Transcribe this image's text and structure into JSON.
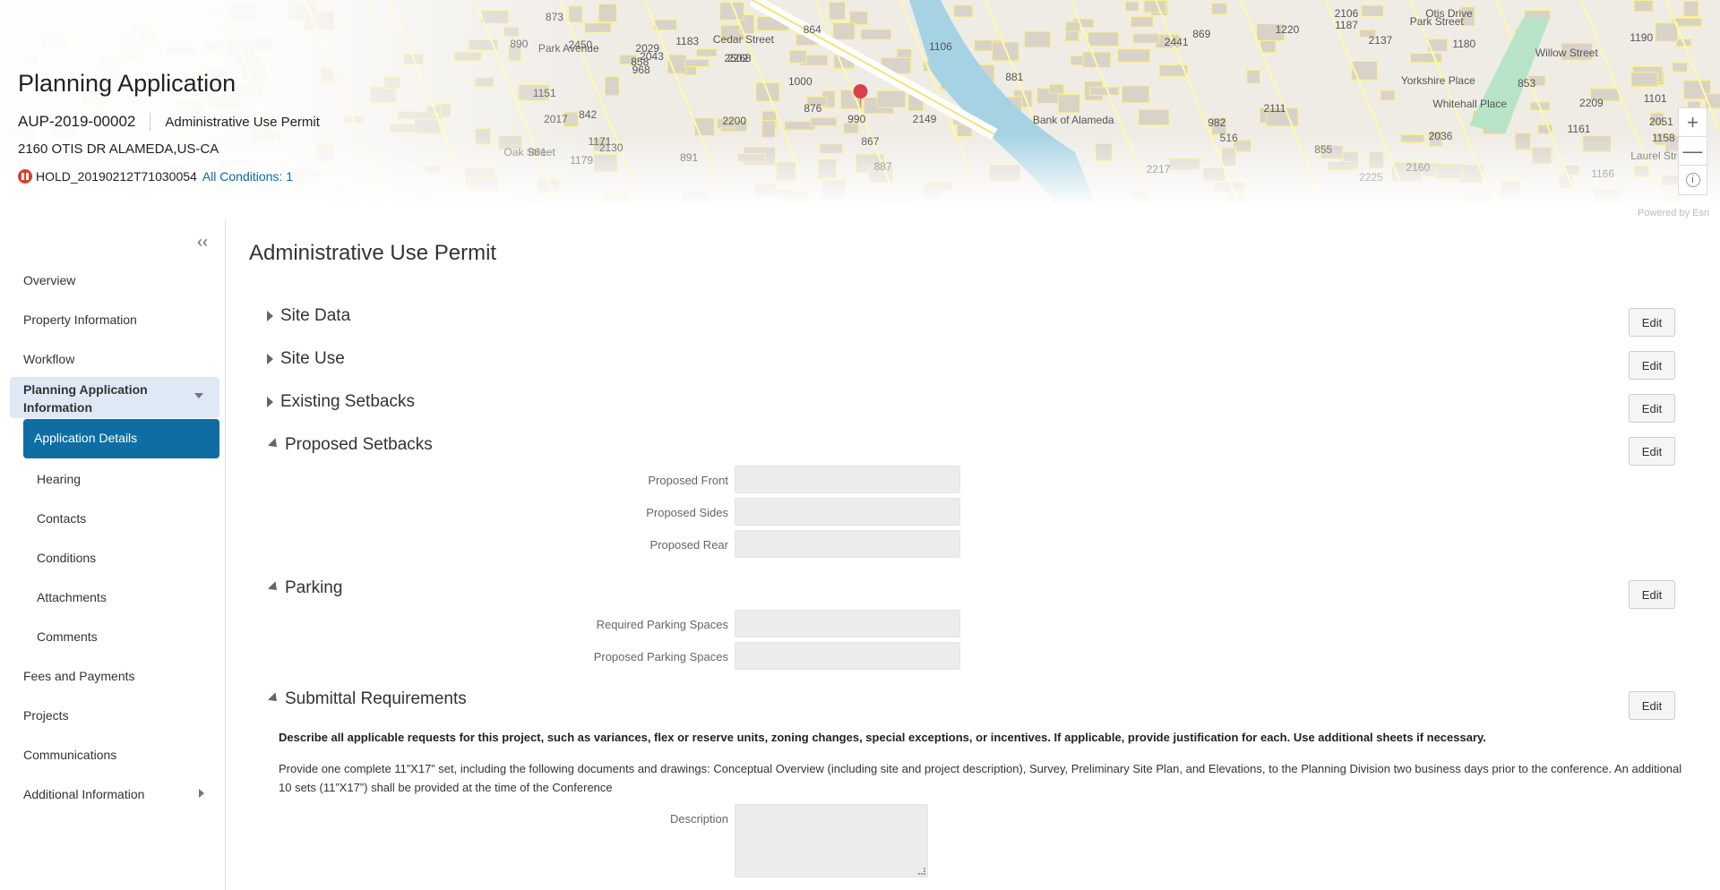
{
  "map": {
    "labels": [
      "Otis Drive",
      "Yorkshire Place",
      "Whitehall Place",
      "Willow Street",
      "Bank of Alameda",
      "2160",
      "2130",
      "2149",
      "2137",
      "2106",
      "2036",
      "2017",
      "2029",
      "2043",
      "2051",
      "516",
      "2111",
      "2209",
      "2217",
      "2225",
      "2200",
      "864",
      "855",
      "858",
      "842",
      "853",
      "861",
      "867",
      "869",
      "876",
      "887",
      "2268",
      "891",
      "881",
      "890",
      "873",
      "1101",
      "1106",
      "1000",
      "990",
      "982",
      "968",
      "1187",
      "1179",
      "1190",
      "2441",
      "2450",
      "1183",
      "2502",
      "1166",
      "1158",
      "1161",
      "1151",
      "1180",
      "1171",
      "1220",
      "Laurel Street",
      "Oak Street",
      "Cedar Street",
      "Park Street",
      "Park Avenue"
    ],
    "zoom_in": "+",
    "zoom_out": "—",
    "info": "i",
    "attribution": "Powered by Esri"
  },
  "header": {
    "title": "Planning Application",
    "record_id": "AUP-2019-00002",
    "record_type": "Administrative Use Permit",
    "address": "2160 OTIS DR ALAMEDA,US-CA",
    "hold_status": "HOLD_20190212T71030054",
    "conditions_link": "All Conditions: 1",
    "status_color": "#d6442a"
  },
  "sidebar": {
    "collapse": "‹‹",
    "items": [
      {
        "label": "Overview"
      },
      {
        "label": "Property Information"
      },
      {
        "label": "Workflow"
      },
      {
        "label": "Planning Application Information"
      },
      {
        "label": "Application Details"
      },
      {
        "label": "Hearing"
      },
      {
        "label": "Contacts"
      },
      {
        "label": "Conditions"
      },
      {
        "label": "Attachments"
      },
      {
        "label": "Comments"
      },
      {
        "label": "Fees and Payments"
      },
      {
        "label": "Projects"
      },
      {
        "label": "Communications"
      },
      {
        "label": "Additional Information"
      }
    ],
    "accent": "#0e6ea3"
  },
  "main": {
    "title": "Administrative Use Permit",
    "edit_label": "Edit",
    "sections": [
      {
        "title": "Site Data",
        "expanded": false
      },
      {
        "title": "Site Use",
        "expanded": false
      },
      {
        "title": "Existing Setbacks",
        "expanded": false
      },
      {
        "title": "Proposed Setbacks",
        "expanded": true,
        "fields": [
          {
            "label": "Proposed Front",
            "value": ""
          },
          {
            "label": "Proposed Sides",
            "value": ""
          },
          {
            "label": "Proposed Rear",
            "value": ""
          }
        ]
      },
      {
        "title": "Parking",
        "expanded": true,
        "fields": [
          {
            "label": "Required Parking Spaces",
            "value": ""
          },
          {
            "label": "Proposed Parking Spaces",
            "value": ""
          }
        ]
      },
      {
        "title": "Submittal Requirements",
        "expanded": true,
        "fields": [
          {
            "label": "Description",
            "value": ""
          }
        ]
      }
    ],
    "submittal_instruction": "Describe all applicable requests for this project, such as variances, flex or reserve units, zoning changes, special exceptions, or incentives. If applicable, provide justification for each. Use additional sheets if necessary.",
    "submittal_text": "Provide one complete 11”X17” set, including the following documents and drawings: Conceptual Overview (including site and project description), Survey, Preliminary Site Plan, and Elevations, to the Planning Division two business days prior to the conference. An additional 10 sets (11”X17”) shall be provided at the time of the Conference"
  }
}
